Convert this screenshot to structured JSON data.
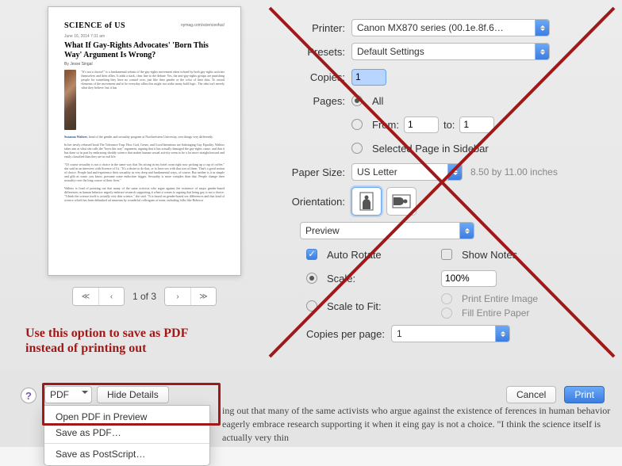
{
  "preview": {
    "logo": "SCIENCE of US",
    "source": "nymag.com/scienceofus/",
    "date": "June 16, 2014  7:31 am",
    "title": "What If Gay-Rights Advocates' 'Born This Way' Argument Is Wrong?",
    "byline": "By Jesse Singal",
    "body1": "\"It's not a choice!\" is a fundamental refrain of the gay-rights movement often echoed by both gay-rights activists themselves and their allies. It adds a stark, clear line to the debate: Yes, the anti-gay-rights groups are punishing people for something they have no control over, just like their gender or the color of their skin. To curtail elements of the movement and to be everyday allies this might not strike many bold logic. The idea isn't merely what they believe, but it has",
    "suzanna": "Suzanna Walters",
    "body2": ", head of the gender and sexuality program at Northwestern University, sees things very differently.",
    "body3": "In her newly released book The Tolerance Trap: How God, Genes, and Good Intentions are Sabotaging Gay Equality, Walters takes aim at what she calls the \"born this way\" argument, arguing that it has actually damaged the gay-rights cause, and that it has done so in part by embracing shoddy science that makes human sexual activity seem to be a lot more straightforward and easily classified than they are in real life.",
    "body4": "\"Of course sexuality is not a choice in the same way that I'm sitting in my hotel room right now picking up a cup of coffee,\" she said in an interview with Science of Us. \"It's a desire to do that, or to have sex with that sort of them. That's a good notion of choice. People had and experience their sexuality in very deep and fundamental ways, of course. But neither is it as simple and glib as some, you know, presume some endocrine trigger. Sexuality is more complex than that. People change their sexuality over the long course of their lives.\"",
    "body5": "Walters is fond of pointing out that many of the same activists who argue against the existence of major gender-based differences in human behavior eagerly embrace research supporting it when it comes to arguing that being gay is not a choice. \"I think the science itself is actually very thin science,\" she said. \"It is based on gender-based sex differences and that kind of science which has been debunked ad nauseam by wonderful colleagues of mine, including folks like Rebecca",
    "link": "Rebecca Jordan-Young"
  },
  "pager": {
    "info": "1 of 3"
  },
  "labels": {
    "printer": "Printer:",
    "presets": "Presets:",
    "copies": "Copies:",
    "pages": "Pages:",
    "all": "All",
    "from": "From:",
    "to": "to:",
    "selected": "Selected Page in Sidebar",
    "papersize": "Paper Size:",
    "paperdim": "8.50 by 11.00 inches",
    "orientation": "Orientation:",
    "autorotate": "Auto Rotate",
    "shownotes": "Show Notes",
    "scale": "Scale:",
    "scaleval": "100%",
    "scaletofit": "Scale to Fit:",
    "printentire": "Print Entire Image",
    "fillpaper": "Fill Entire Paper",
    "copiesper": "Copies per page:"
  },
  "values": {
    "printer": "Canon MX870 series (00.1e.8f.6…",
    "presets": "Default Settings",
    "copies": "1",
    "from": "1",
    "to": "1",
    "papersize": "US Letter",
    "section": "Preview",
    "copiesper": "1"
  },
  "footer": {
    "pdf": "PDF",
    "hide": "Hide Details",
    "cancel": "Cancel",
    "print": "Print"
  },
  "pdfmenu": {
    "open": "Open PDF in Preview",
    "save": "Save as PDF…",
    "ps": "Save as PostScript…"
  },
  "annotation": "Use this option to save as PDF instead of printing out",
  "bg": "ing out that many of the same activists who argue against the existence of ferences in human behavior eagerly embrace research supporting it when it eing gay is not a choice. \"I think the science itself is actually very thin"
}
